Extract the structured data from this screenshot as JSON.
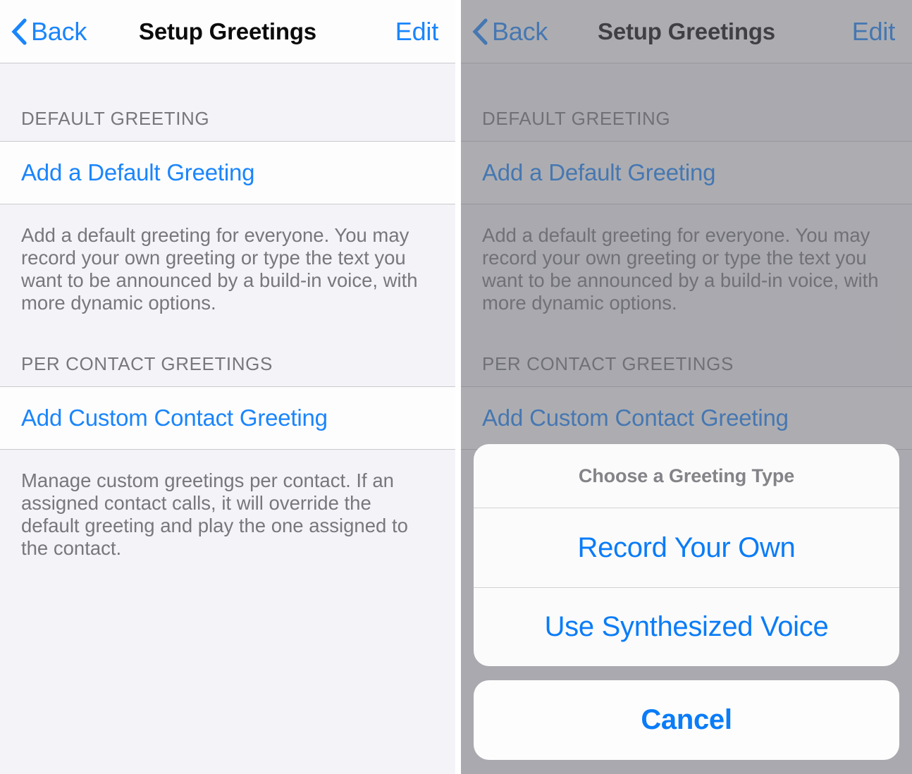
{
  "navbar": {
    "back_label": "Back",
    "title": "Setup Greetings",
    "edit_label": "Edit",
    "back_icon": "chevron-left-icon"
  },
  "sections": [
    {
      "header": "DEFAULT GREETING",
      "row_label": "Add a Default Greeting",
      "footnote": "Add a default greeting for everyone. You may record your own greeting or type the text you want to be announced by a build-in voice, with more dynamic options."
    },
    {
      "header": "PER CONTACT GREETINGS",
      "row_label": "Add Custom Contact Greeting",
      "footnote": "Manage custom greetings per contact. If an assigned contact calls, it will override the default greeting and play the one assigned to the contact."
    }
  ],
  "action_sheet": {
    "title": "Choose a Greeting Type",
    "options": [
      {
        "label": "Record Your Own"
      },
      {
        "label": "Use Synthesized Voice"
      }
    ],
    "cancel_label": "Cancel"
  },
  "colors": {
    "accent_blue": "#0a7cf8",
    "nav_blue": "#1a85fc",
    "page_background": "#f4f4f8",
    "cell_background": "#fdfdfd",
    "separator": "#c9c9ce",
    "secondary_text": "#77777c",
    "dim_overlay": "#6c6c72",
    "sheet_title_text": "#838388"
  }
}
